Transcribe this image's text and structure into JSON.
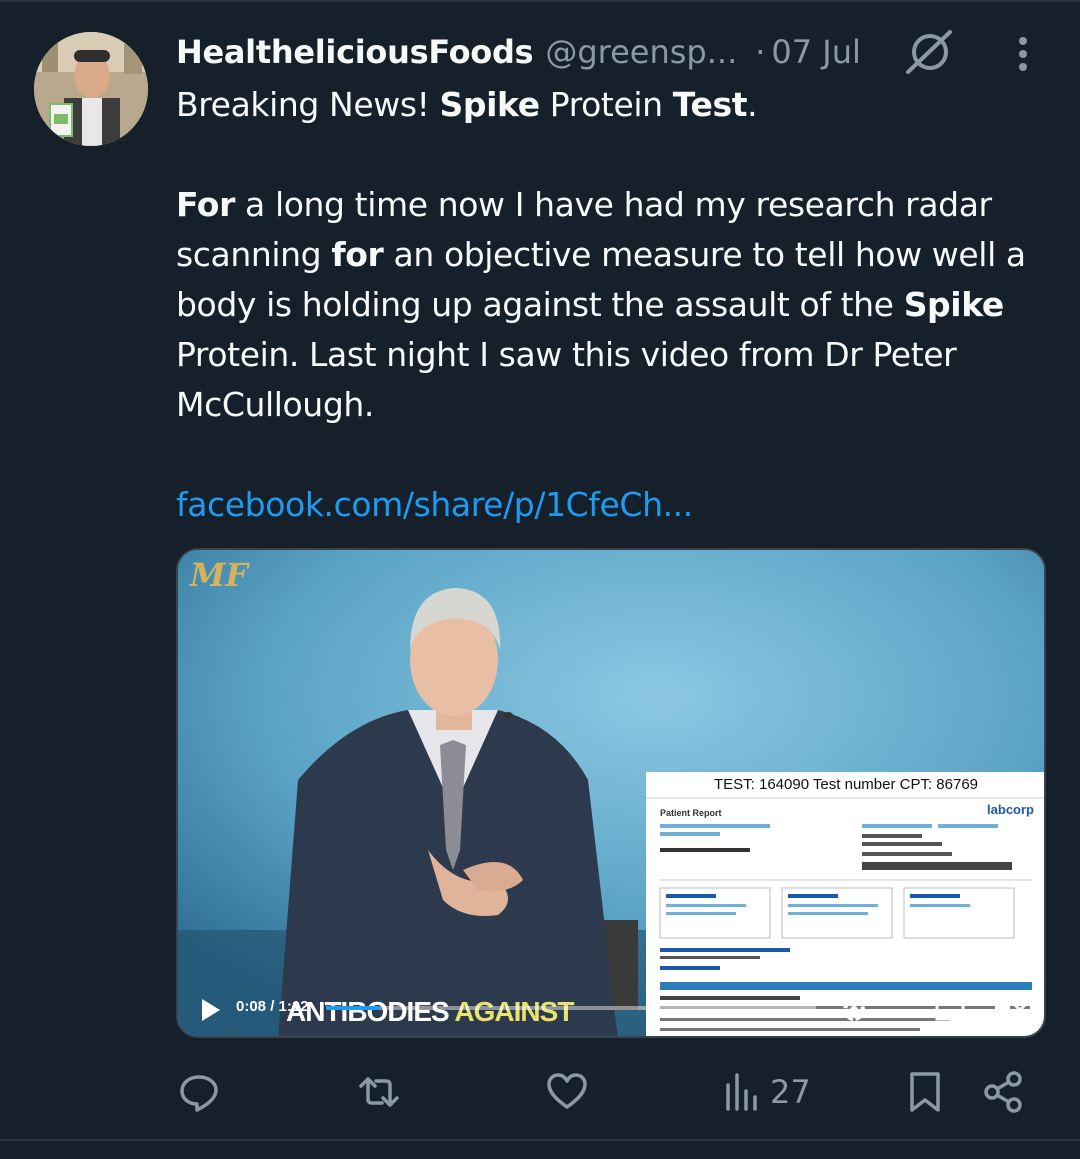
{
  "tweet": {
    "display_name": "HealtheliciousFoods",
    "handle": "@greensp...",
    "separator": "·",
    "date": "07 Jul",
    "body": {
      "line1_a": "Breaking News! ",
      "line1_b": "Spike",
      "line1_c": " Protein ",
      "line1_d": "Test",
      "line1_e": ".",
      "p2_a": "For",
      "p2_b": " a long time now I have had my research radar scanning ",
      "p2_c": "for",
      "p2_d": " an objective measure to tell how well a body is holding up against the assault of the ",
      "p2_e": "Spike",
      "p2_f": " Protein. Last night I saw this video from Dr Peter McCullough."
    },
    "link_text": "facebook.com/share/p/1CfeCh..."
  },
  "media": {
    "logo_text": "MF",
    "report_title": "TEST: 164090 Test number CPT: 86769",
    "report_label": "Patient Report",
    "report_brand": "labcorp",
    "caption_a": "ANTIBODIES ",
    "caption_b": "AGAINST",
    "time": "0:08 / 1:12",
    "progress_fraction": 0.11
  },
  "actions": {
    "views_count": "27"
  },
  "icons": {
    "reply": "reply-icon",
    "retweet": "retweet-icon",
    "like": "heart-icon",
    "views": "views-icon",
    "bookmark": "bookmark-icon",
    "share": "share-icon",
    "grok": "grok-icon",
    "more": "more-icon"
  },
  "colors": {
    "background": "#15202b",
    "text": "#f7f9f9",
    "muted": "#8b98a5",
    "link": "#1d9bf0"
  }
}
